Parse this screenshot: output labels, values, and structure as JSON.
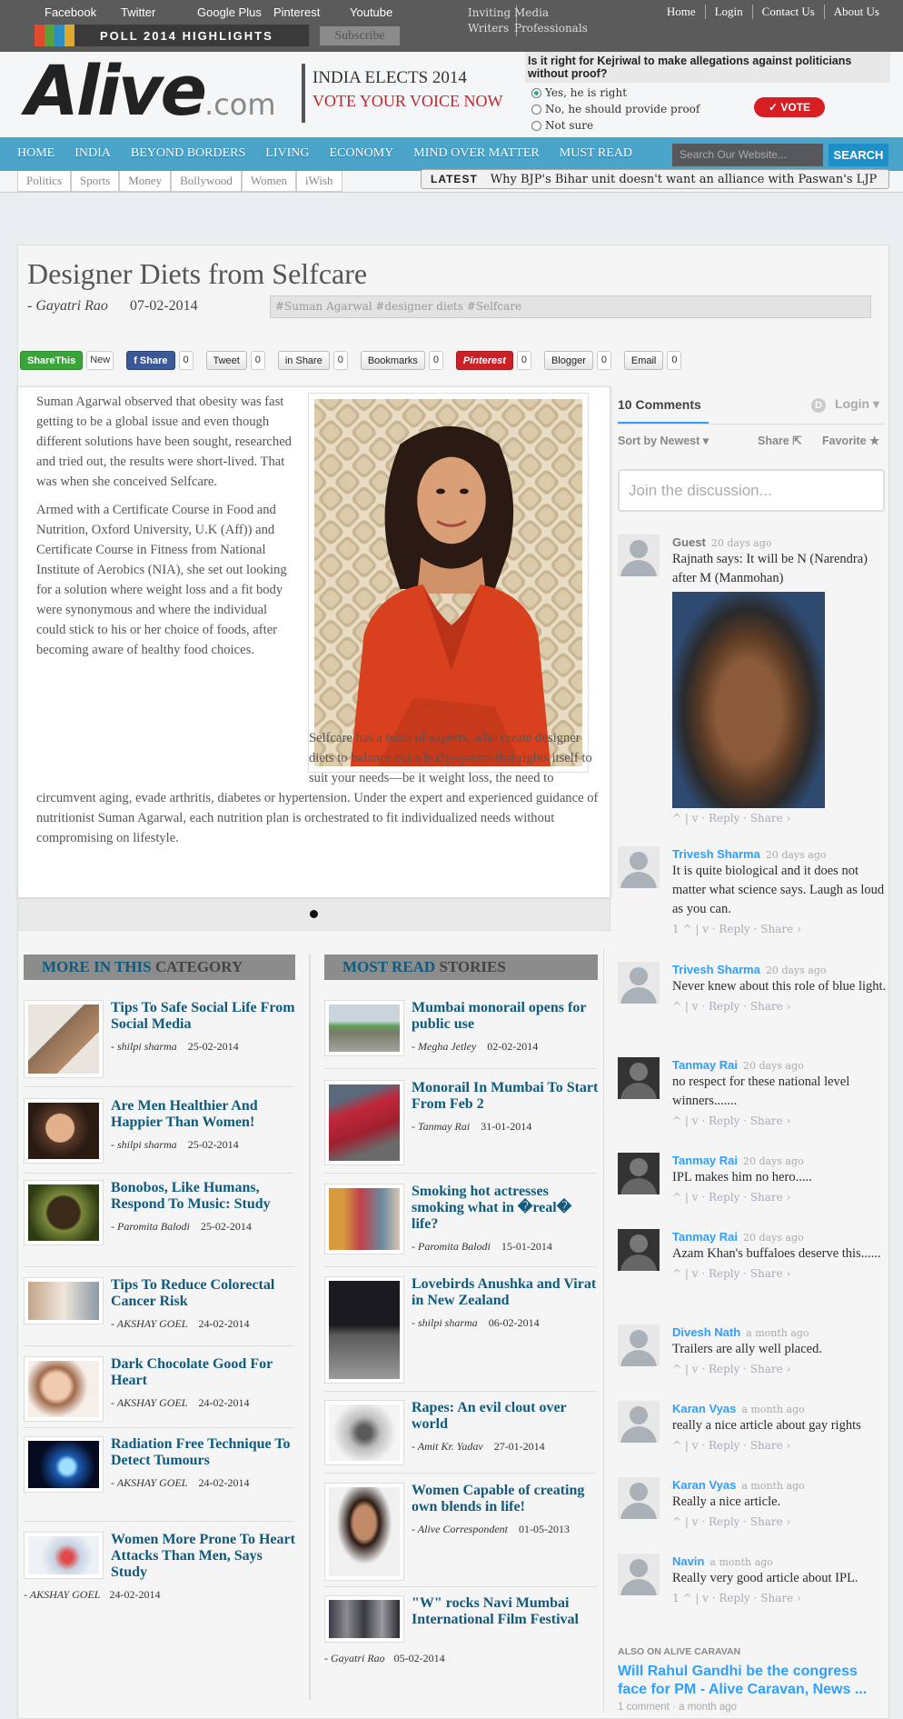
{
  "topbar": {
    "social": [
      "Facebook",
      "Twitter",
      "Google Plus",
      "Pinterest",
      "Youtube"
    ],
    "poll_highlights": "POLL 2014 HIGHLIGHTS",
    "subscribe": "Subscribe",
    "inviting": [
      "Inviting",
      "Writers"
    ],
    "media": [
      "Media",
      "Professionals"
    ],
    "links": [
      "Home",
      "Login",
      "Contact Us",
      "About Us"
    ]
  },
  "header": {
    "logo_main": "Alive",
    "logo_domain": ".com",
    "elects_line1": "INDIA ELECTS 2014",
    "elects_line2": "VOTE YOUR VOICE NOW",
    "poll_question": "Is it right for Kejriwal to make allegations against politicians without proof?",
    "poll_options": [
      "Yes, he is right",
      "No, he should provide proof",
      "Not sure"
    ],
    "vote_label": "✓ VOTE"
  },
  "nav": {
    "items": [
      "HOME",
      "INDIA",
      "BEYOND BORDERS",
      "LIVING",
      "ECONOMY",
      "MIND OVER MATTER",
      "MUST READ"
    ],
    "search_placeholder": "Search Our Website...",
    "search_button": "SEARCH"
  },
  "subnav": {
    "items": [
      "Politics",
      "Sports",
      "Money",
      "Bollywood",
      "Women",
      "iWish"
    ],
    "latest_label": "LATEST",
    "latest_text": "Why BJP's Bihar unit doesn't want an alliance with Paswan's LJP"
  },
  "article": {
    "title": "Designer Diets from Selfcare",
    "author": "- Gayatri Rao",
    "date": "07-02-2014",
    "tags": "#Suman Agarwal #designer diets #Selfcare",
    "paragraphs": [
      "Suman Agarwal observed that obesity was fast getting to be a global issue and even though different solutions have been sought, researched and tried out, the results were short-lived. That was when she conceived Selfcare.",
      "Armed with a Certificate Course in Food and Nutrition, Oxford University, U.K (Aff)) and Certificate Course in Fitness from National Institute of Aerobics (NIA), she set out looking for a solution where weight loss and a fit body were synonymous and where the individual could stick to his or her choice of foods, after becoming aware of healthy food choices.",
      "Selfcare has a team of experts, who create designer diets to balance out a body-system that rights itself to suit your needs—be it weight loss, the need to circumvent aging, evade arthritis, diabetes or hypertension. Under the expert and experienced guidance of nutritionist Suman Agarwal, each nutrition plan is orchestrated to fit individualized needs without compromising on lifestyle."
    ]
  },
  "share": [
    {
      "label": "ShareThis",
      "count": "New"
    },
    {
      "label": "f Share",
      "count": "0"
    },
    {
      "label": "Tweet",
      "count": "0"
    },
    {
      "label": "in Share",
      "count": "0"
    },
    {
      "label": "Bookmarks",
      "count": "0"
    },
    {
      "label": "Pinterest",
      "count": "0"
    },
    {
      "label": "Blogger",
      "count": "0"
    },
    {
      "label": "Email",
      "count": "0"
    }
  ],
  "more_category": {
    "heading_hl": "MORE IN THIS",
    "heading_rest": "CATEGORY",
    "stories": [
      {
        "title": "Tips To Safe Social Life From Social Media",
        "author": "- shilpi sharma",
        "date": "25-02-2014"
      },
      {
        "title": "Are Men Healthier And Happier Than Women!",
        "author": "- shilpi sharma",
        "date": "25-02-2014"
      },
      {
        "title": "Bonobos, Like Humans, Respond To Music: Study",
        "author": "- Paromita Balodi",
        "date": "25-02-2014"
      },
      {
        "title": "Tips To Reduce Colorectal Cancer Risk",
        "author": "- AKSHAY GOEL",
        "date": "24-02-2014"
      },
      {
        "title": "Dark Chocolate Good For Heart",
        "author": "- AKSHAY GOEL",
        "date": "24-02-2014"
      },
      {
        "title": "Radiation Free Technique To Detect Tumours",
        "author": "- AKSHAY GOEL",
        "date": "24-02-2014"
      },
      {
        "title": "Women More Prone To Heart Attacks Than Men, Says Study",
        "author": "- AKSHAY GOEL",
        "date": "24-02-2014"
      }
    ]
  },
  "most_read": {
    "heading_hl": "MOST READ",
    "heading_rest": "STORIES",
    "stories": [
      {
        "title": "Mumbai monorail opens for public use",
        "author": "- Megha Jetley",
        "date": "02-02-2014"
      },
      {
        "title": "Monorail In Mumbai To Start From Feb 2",
        "author": "- Tanmay Rai",
        "date": "31-01-2014"
      },
      {
        "title": "Smoking hot actresses smoking what in �real� life?",
        "author": "- Paromita Balodi",
        "date": "15-01-2014"
      },
      {
        "title": "Lovebirds Anushka and Virat in New Zealand",
        "author": "- shilpi sharma",
        "date": "06-02-2014"
      },
      {
        "title": "Rapes: An evil clout over world",
        "author": "- Amit Kr. Yadav",
        "date": "27-01-2014"
      },
      {
        "title": "Women Capable of creating own blends in life!",
        "author": "- Alive Correspondent",
        "date": "01-05-2013"
      },
      {
        "title": "\"W\" rocks Navi Mumbai International Film Festival",
        "author": "- Gayatri Rao",
        "date": "05-02-2014"
      }
    ]
  },
  "disqus": {
    "count_label": "10 Comments",
    "login": "Login",
    "sort": "Sort by Newest",
    "share": "Share",
    "favorite": "Favorite",
    "join_placeholder": "Join the discussion...",
    "comments": [
      {
        "name": "Guest",
        "time": "20 days ago",
        "text": "Rajnath says: It will be N (Narendra) after M (Manmohan)",
        "actions": "^  |  v  ·  Reply  ·  Share ›"
      },
      {
        "name": "Trivesh Sharma",
        "time": "20 days ago",
        "text": "It is quite biological and it does not matter what science says. Laugh as loud as you can.",
        "actions": "1  ^  |  v  ·  Reply  ·  Share ›"
      },
      {
        "name": "Trivesh Sharma",
        "time": "20 days ago",
        "text": "Never knew about this role of blue light.",
        "actions": "^  |  v  ·  Reply  ·  Share ›"
      },
      {
        "name": "Tanmay Rai",
        "time": "20 days ago",
        "text": "no respect for these national level winners.......",
        "actions": "^  |  v  ·  Reply  ·  Share ›"
      },
      {
        "name": "Tanmay Rai",
        "time": "20 days ago",
        "text": "IPL makes him no hero.....",
        "actions": "^  |  v  ·  Reply  ·  Share ›"
      },
      {
        "name": "Tanmay Rai",
        "time": "20 days ago",
        "text": "Azam Khan's buffaloes deserve this......",
        "actions": "^  |  v  ·  Reply  ·  Share ›"
      },
      {
        "name": "Divesh Nath",
        "time": "a month ago",
        "text": "Trailers are ally well placed.",
        "actions": "^  |  v  ·  Reply  ·  Share ›"
      },
      {
        "name": "Karan Vyas",
        "time": "a month ago",
        "text": "really a nice article about gay rights",
        "actions": "^  |  v  ·  Reply  ·  Share ›"
      },
      {
        "name": "Karan Vyas",
        "time": "a month ago",
        "text": "Really a nice article.",
        "actions": "^  |  v  ·  Reply  ·  Share ›"
      },
      {
        "name": "Navin",
        "time": "a month ago",
        "text": "Really very good article about IPL.",
        "actions": "1  ^  |  v  ·  Reply  ·  Share ›"
      }
    ],
    "also_on": "ALSO ON ALIVE CARAVAN",
    "also_title": "Will Rahul Gandhi be the congress face for PM - Alive Caravan, News ...",
    "also_meta": "1 comment · a month ago"
  }
}
